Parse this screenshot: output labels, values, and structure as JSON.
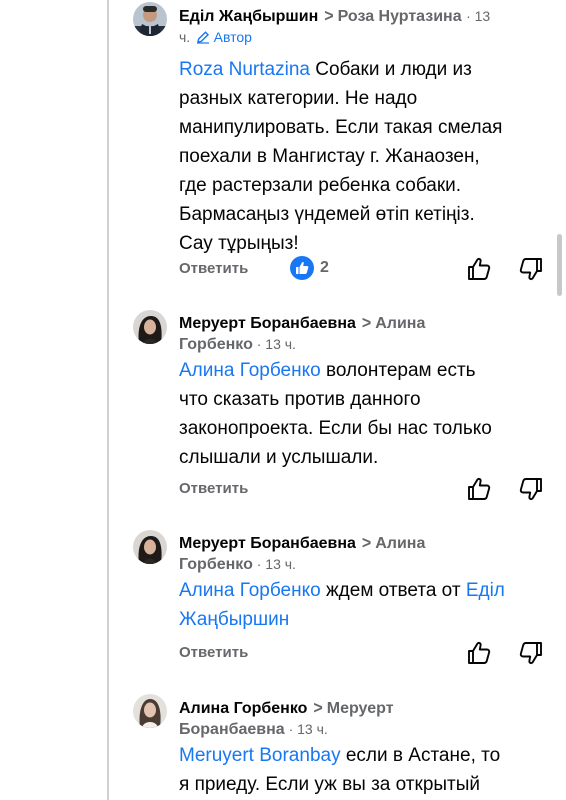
{
  "comments": [
    {
      "author": "Еділ Жаңбыршин",
      "reply_to": "Роза Нуртазина",
      "time_a": "· 13",
      "time_b": "ч.",
      "badge": "Автор",
      "mention": "Roza  Nurtazina",
      "lines": [
        " Собаки и люди из",
        "разных категории. Не надо",
        "манипулировать. Если такая смелая",
        "поехали в Мангистау г. Жанаозен,",
        "где растерзали ребенка собаки.",
        "Бармасаңыз үндемей өтіп кетіңіз.",
        "Сау тұрыңыз!"
      ],
      "reply_label": "Ответить",
      "reaction_count": "2"
    },
    {
      "author": "Меруерт Боранбаевна",
      "reply_to_a": "Алина",
      "reply_to_b": "Горбенко",
      "time": " · 13 ч.",
      "mention": "Алина Горбенко",
      "lines": [
        "  волонтерам есть",
        "что сказать против данного",
        "законопроекта.  Если бы нас только",
        "слышали и услышали."
      ],
      "reply_label": "Ответить"
    },
    {
      "author": "Меруерт Боранбаевна",
      "reply_to_a": "Алина",
      "reply_to_b": "Горбенко",
      "time": " · 13 ч.",
      "mention": "Алина Горбенко",
      "text_mid": " ждем ответа от ",
      "mention2_a": "Еділ",
      "mention2_b": "Жаңбыршин",
      "reply_label": "Ответить"
    },
    {
      "author": "Алина Горбенко",
      "reply_to_a": "Меруерт",
      "reply_to_b": "Боранбаевна",
      "time": " · 13 ч.",
      "mention": "Meruyert Boranbay",
      "lines": [
        " если в Астане, то",
        "я приеду. Если уж вы за открытый"
      ]
    }
  ],
  "colors": {
    "accent": "#1877f2",
    "muted": "#65676b",
    "text": "#050505"
  }
}
